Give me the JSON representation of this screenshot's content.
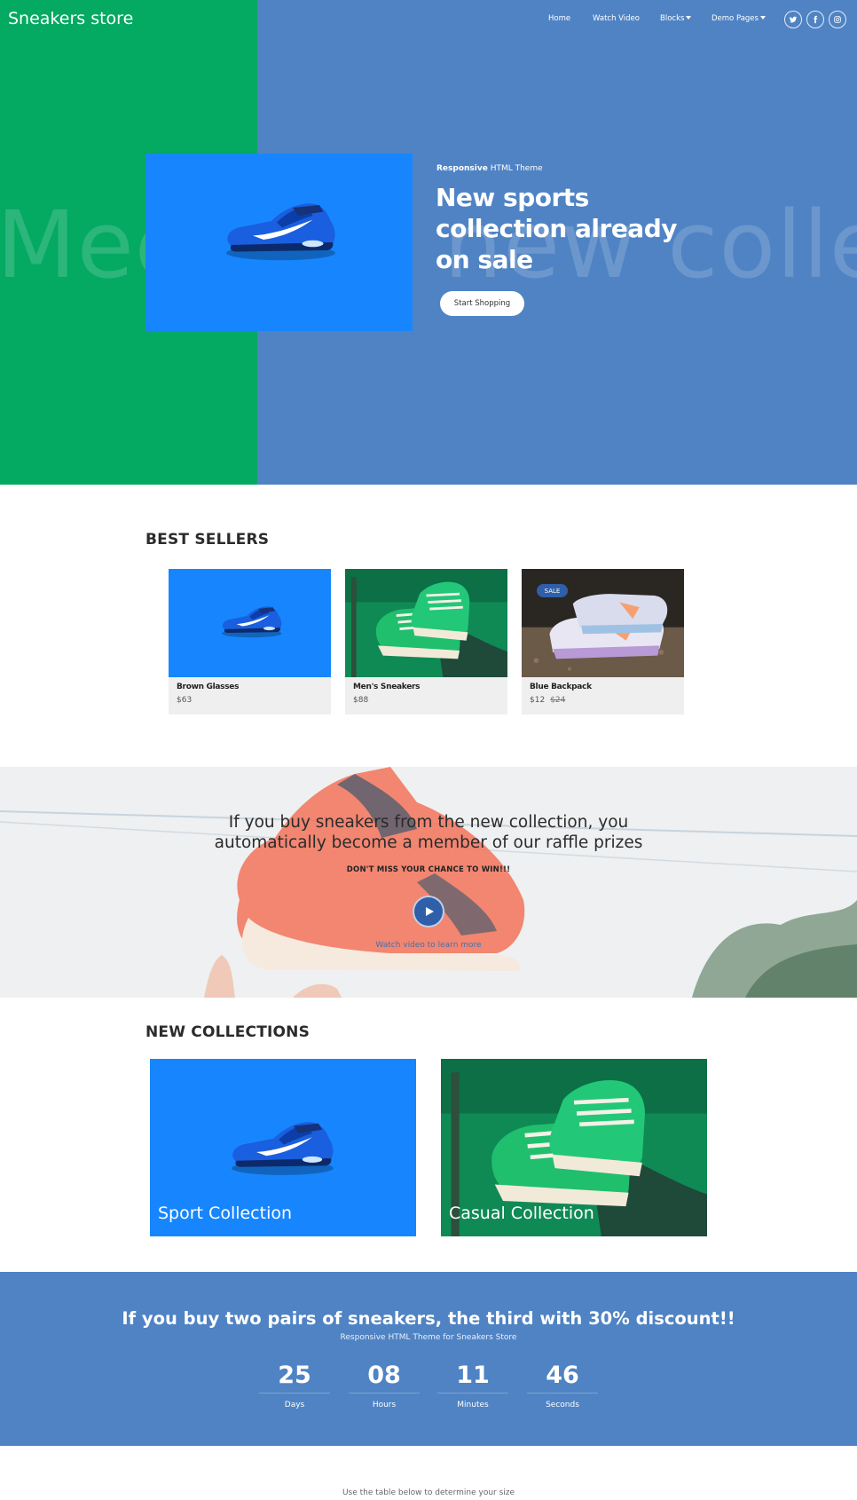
{
  "header": {
    "brand": "Sneakers store",
    "nav": [
      {
        "label": "Home"
      },
      {
        "label": "Watch Video"
      },
      {
        "label": "Blocks"
      },
      {
        "label": "Demo Pages"
      }
    ],
    "social_icons": [
      "twitter-icon",
      "facebook-icon",
      "instagram-icon"
    ]
  },
  "hero": {
    "background_text": "Meet the new collection",
    "eyebrow_bold": "Responsive",
    "eyebrow_rest": " HTML Theme",
    "title_lines": [
      "New sports",
      "collection already",
      "on sale"
    ],
    "cta_label": "Start Shopping",
    "colors": {
      "green": "#04a962",
      "blue": "#4f83c4",
      "image_bg": "#1786fe"
    }
  },
  "best_sellers": {
    "title": "BEST SELLERS",
    "products": [
      {
        "name": "Brown Glasses",
        "price": "$63",
        "old_price": "",
        "badge": ""
      },
      {
        "name": "Men's Sneakers",
        "price": "$88",
        "old_price": "",
        "badge": ""
      },
      {
        "name": "Blue Backpack",
        "price": "$12",
        "old_price": "$24",
        "badge": "SALE"
      }
    ]
  },
  "promo": {
    "line1": "If you buy sneakers from the new collection, you",
    "line2": "automatically become a member of our raffle prizes",
    "subtitle": "DON'T MISS YOUR CHANCE TO WIN!!!",
    "video_link": "Watch video to learn more"
  },
  "new_collections": {
    "title": "NEW COLLECTIONS",
    "items": [
      {
        "label": "Sport Collection"
      },
      {
        "label": "Casual Collection"
      }
    ]
  },
  "discount": {
    "title": "If you buy two pairs of sneakers, the third with 30% discount!!",
    "subtitle": "Responsive HTML Theme for Sneakers Store",
    "countdown": [
      {
        "value": "25",
        "label": "Days"
      },
      {
        "value": "08",
        "label": "Hours"
      },
      {
        "value": "11",
        "label": "Minutes"
      },
      {
        "value": "46",
        "label": "Seconds"
      }
    ]
  },
  "size_table": {
    "note": "Use the table below to determine your size"
  }
}
